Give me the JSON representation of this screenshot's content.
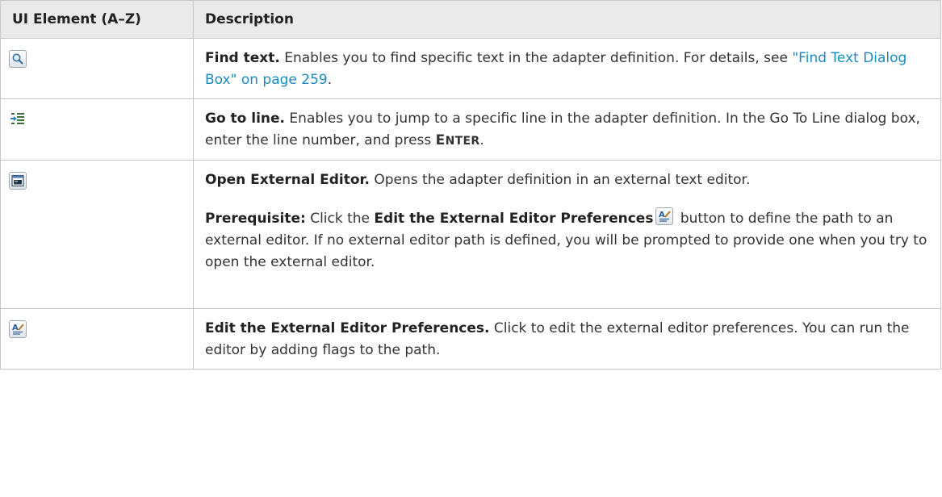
{
  "table": {
    "headers": {
      "element": "UI Element (A–Z)",
      "description": "Description"
    },
    "rows": [
      {
        "icon": "find-text-icon",
        "title": "Find text.",
        "text_before_link": " Enables you to find specific text in the adapter definition. For details, see ",
        "link": "\"Find Text Dialog Box\" on page 259",
        "text_after_link": "."
      },
      {
        "icon": "go-to-line-icon",
        "title": "Go to line.",
        "text": " Enables you to jump to a specific line in the adapter definition. In the Go To Line dialog box, enter the line number, and press ",
        "key": "Enter",
        "key_first": "E",
        "key_rest": "NTER",
        "text_end": "."
      },
      {
        "icon": "external-editor-icon",
        "title": "Open External Editor.",
        "text": " Opens the adapter definition in an external text editor.",
        "prereq_label": "Prerequisite:",
        "prereq_text1": " Click the ",
        "prereq_button": "Edit the External Editor Preferences",
        "prereq_text2": " button to define the path to an external editor. If no external editor path is defined, you will be prompted to provide one when you try to open the external editor."
      },
      {
        "icon": "editor-preferences-icon",
        "title": "Edit the External Editor Preferences.",
        "text": " Click to edit the external editor preferences. You can run the editor by adding flags to the path."
      }
    ]
  }
}
